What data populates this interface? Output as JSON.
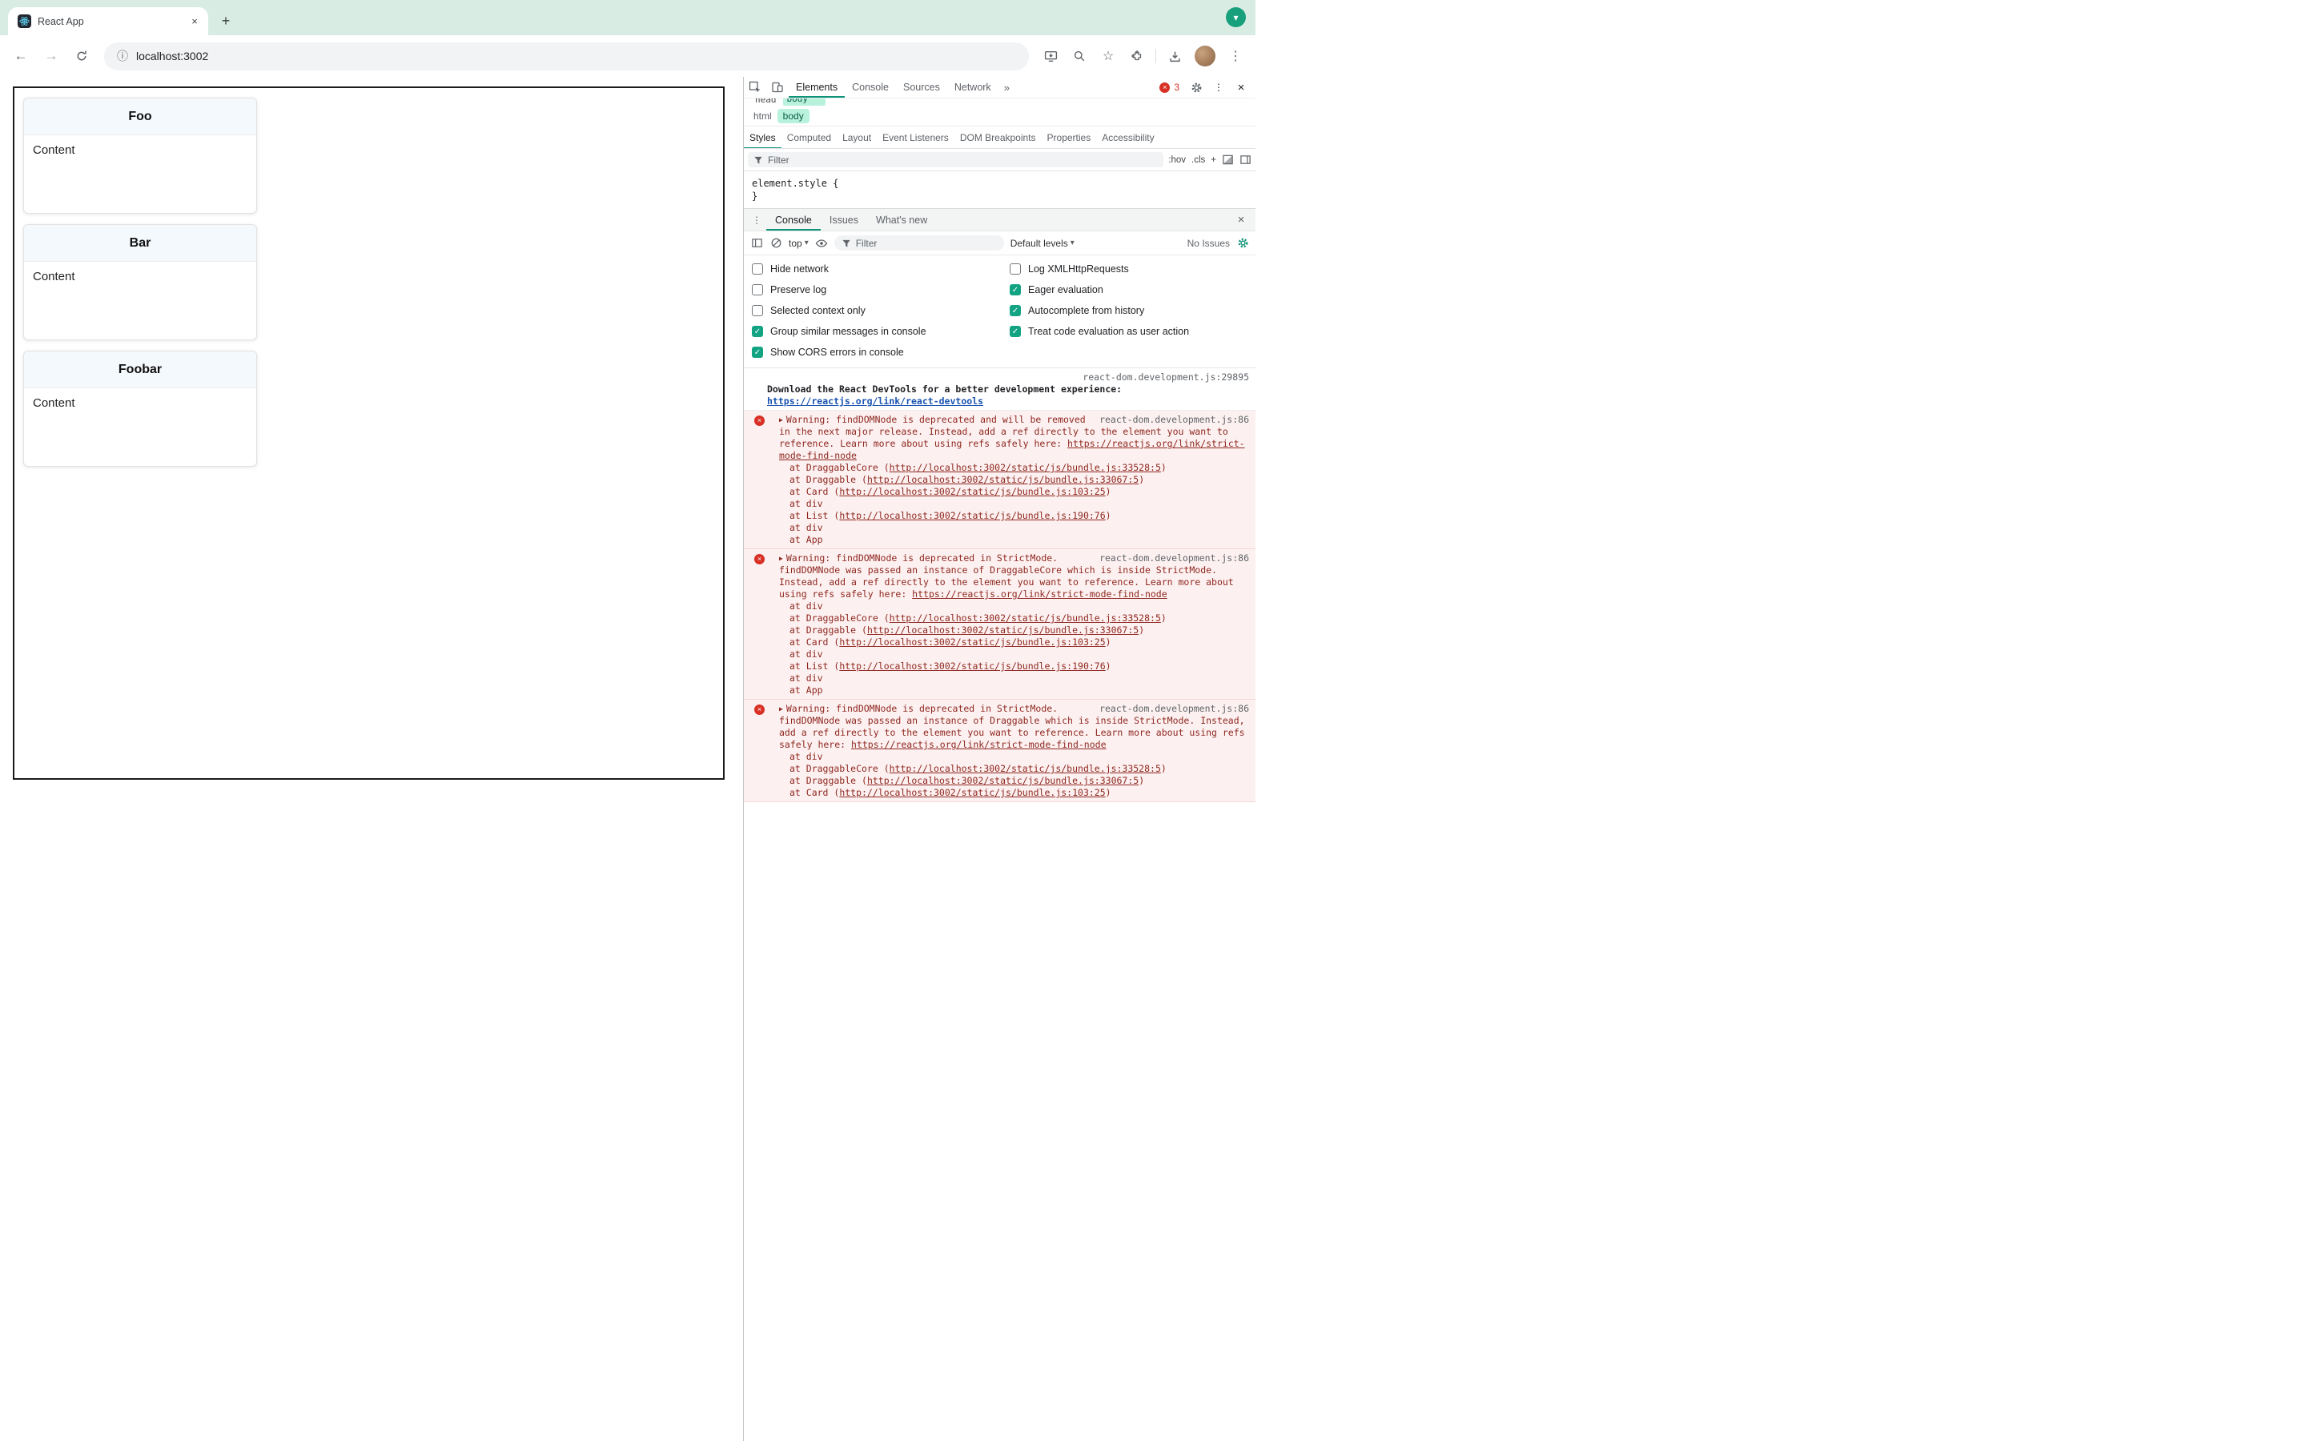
{
  "icons": {
    "close": "×",
    "plus": "+",
    "dropdown": "▾",
    "back": "←",
    "forward": "→",
    "info": "ⓘ",
    "star": "☆",
    "kebab": "⋮",
    "more_tabs": "»",
    "expand": "▶",
    "check": "✓"
  },
  "browser": {
    "tab_title": "React App",
    "url": "localhost:3002"
  },
  "page": {
    "cards": [
      {
        "title": "Foo",
        "body": "Content"
      },
      {
        "title": "Bar",
        "body": "Content"
      },
      {
        "title": "Foobar",
        "body": "Content"
      }
    ]
  },
  "devtools": {
    "toolbar": {
      "tabs": [
        {
          "label": "Elements",
          "selected": true
        },
        {
          "label": "Console",
          "selected": false
        },
        {
          "label": "Sources",
          "selected": false
        },
        {
          "label": "Network",
          "selected": false
        }
      ],
      "error_count": "3"
    },
    "elements_panel": {
      "tree_clipped": {
        "plain": "head",
        "selected": "body"
      },
      "breadcrumbs": [
        {
          "label": "html",
          "selected": false
        },
        {
          "label": "body",
          "selected": true
        }
      ],
      "tabs": [
        {
          "label": "Styles",
          "selected": true
        },
        {
          "label": "Computed",
          "selected": false
        },
        {
          "label": "Layout",
          "selected": false
        },
        {
          "label": "Event Listeners",
          "selected": false
        },
        {
          "label": "DOM Breakpoints",
          "selected": false
        },
        {
          "label": "Properties",
          "selected": false
        },
        {
          "label": "Accessibility",
          "selected": false
        }
      ],
      "filter_placeholder": "Filter",
      "toggles": [
        ":hov",
        ".cls",
        "+"
      ],
      "element_style_open": "element.style {",
      "element_style_close": "}"
    },
    "drawer": {
      "tabs": [
        {
          "label": "Console",
          "selected": true
        },
        {
          "label": "Issues",
          "selected": false
        },
        {
          "label": "What's new",
          "selected": false
        }
      ]
    },
    "console": {
      "context": "top",
      "filter_placeholder": "Filter",
      "levels": "Default levels",
      "issues_label": "No Issues",
      "settings_left": [
        {
          "label": "Hide network",
          "checked": false
        },
        {
          "label": "Preserve log",
          "checked": false
        },
        {
          "label": "Selected context only",
          "checked": false
        },
        {
          "label": "Group similar messages in console",
          "checked": true
        },
        {
          "label": "Show CORS errors in console",
          "checked": true
        }
      ],
      "settings_right": [
        {
          "label": "Log XMLHttpRequests",
          "checked": false
        },
        {
          "label": "Eager evaluation",
          "checked": true
        },
        {
          "label": "Autocomplete from history",
          "checked": true
        },
        {
          "label": "Treat code evaluation as user action",
          "checked": true
        }
      ],
      "messages": [
        {
          "type": "info",
          "source": "react-dom.development.js:29895",
          "parts": [
            {
              "text": "Download the React DevTools for a better development experience:",
              "bold": true
            },
            {
              "text": "https://reactjs.org/link/react-devtools",
              "bold": true,
              "link": true,
              "break_before": true
            }
          ],
          "stack": []
        },
        {
          "type": "error",
          "source": "react-dom.development.js:86",
          "parts": [
            {
              "text": "Warning: findDOMNode is deprecated and will be removed in the next major release. Instead, add a ref directly to the element you want to reference. Learn more about using refs safely here: "
            },
            {
              "text": "https://reactjs.org/link/strict-mode-find-node",
              "link": true
            }
          ],
          "stack": [
            {
              "text": "at DraggableCore (",
              "link": "http://localhost:3002/static/js/bundle.js:33528:5",
              "after": ")"
            },
            {
              "text": "at Draggable (",
              "link": "http://localhost:3002/static/js/bundle.js:33067:5",
              "after": ")"
            },
            {
              "text": "at Card (",
              "link": "http://localhost:3002/static/js/bundle.js:103:25",
              "after": ")"
            },
            {
              "text": "at div"
            },
            {
              "text": "at List (",
              "link": "http://localhost:3002/static/js/bundle.js:190:76",
              "after": ")"
            },
            {
              "text": "at div"
            },
            {
              "text": "at App"
            }
          ]
        },
        {
          "type": "error",
          "source": "react-dom.development.js:86",
          "parts": [
            {
              "text": "Warning: findDOMNode is deprecated in StrictMode. findDOMNode was passed an instance of DraggableCore which is inside StrictMode. Instead, add a ref directly to the element you want to reference. Learn more about using refs safely here: "
            },
            {
              "text": "https://reactjs.org/link/strict-mode-find-node",
              "link": true
            }
          ],
          "stack": [
            {
              "text": "at div"
            },
            {
              "text": "at DraggableCore (",
              "link": "http://localhost:3002/static/js/bundle.js:33528:5",
              "after": ")"
            },
            {
              "text": "at Draggable (",
              "link": "http://localhost:3002/static/js/bundle.js:33067:5",
              "after": ")"
            },
            {
              "text": "at Card (",
              "link": "http://localhost:3002/static/js/bundle.js:103:25",
              "after": ")"
            },
            {
              "text": "at div"
            },
            {
              "text": "at List (",
              "link": "http://localhost:3002/static/js/bundle.js:190:76",
              "after": ")"
            },
            {
              "text": "at div"
            },
            {
              "text": "at App"
            }
          ]
        },
        {
          "type": "error",
          "source": "react-dom.development.js:86",
          "parts": [
            {
              "text": "Warning: findDOMNode is deprecated in StrictMode. findDOMNode was passed an instance of Draggable which is inside StrictMode. Instead, add a ref directly to the element you want to reference. Learn more about using refs safely here: "
            },
            {
              "text": "https://reactjs.org/link/strict-mode-find-node",
              "link": true
            }
          ],
          "stack": [
            {
              "text": "at div"
            },
            {
              "text": "at DraggableCore (",
              "link": "http://localhost:3002/static/js/bundle.js:33528:5",
              "after": ")"
            },
            {
              "text": "at Draggable (",
              "link": "http://localhost:3002/static/js/bundle.js:33067:5",
              "after": ")"
            },
            {
              "text": "at Card (",
              "link": "http://localhost:3002/static/js/bundle.js:103:25",
              "after": ")"
            }
          ]
        }
      ]
    }
  }
}
